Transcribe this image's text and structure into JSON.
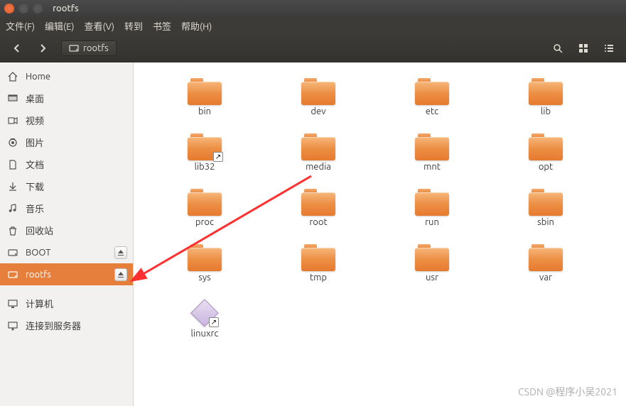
{
  "window": {
    "title": "rootfs"
  },
  "menubar": [
    "文件(F)",
    "编辑(E)",
    "查看(V)",
    "转到",
    "书签",
    "帮助(H)"
  ],
  "path": {
    "current": "rootfs"
  },
  "sidebar": {
    "items": [
      {
        "icon": "home",
        "label": "Home",
        "active": false
      },
      {
        "icon": "desktop",
        "label": "桌面",
        "active": false
      },
      {
        "icon": "video",
        "label": "视频",
        "active": false
      },
      {
        "icon": "pictures",
        "label": "图片",
        "active": false
      },
      {
        "icon": "documents",
        "label": "文档",
        "active": false
      },
      {
        "icon": "downloads",
        "label": "下载",
        "active": false
      },
      {
        "icon": "music",
        "label": "音乐",
        "active": false
      },
      {
        "icon": "trash",
        "label": "回收站",
        "active": false
      },
      {
        "icon": "drive",
        "label": "BOOT",
        "active": false,
        "eject": true
      },
      {
        "icon": "drive",
        "label": "rootfs",
        "active": true,
        "eject": true
      }
    ],
    "footer": [
      {
        "icon": "computer",
        "label": "计算机"
      },
      {
        "icon": "network",
        "label": "连接到服务器"
      }
    ]
  },
  "files": [
    {
      "type": "folder",
      "label": "bin"
    },
    {
      "type": "folder",
      "label": "dev"
    },
    {
      "type": "folder",
      "label": "etc"
    },
    {
      "type": "folder",
      "label": "lib"
    },
    {
      "type": "folder",
      "label": "lib32",
      "shortcut": true
    },
    {
      "type": "folder",
      "label": "media"
    },
    {
      "type": "folder",
      "label": "mnt"
    },
    {
      "type": "folder",
      "label": "opt"
    },
    {
      "type": "folder",
      "label": "proc"
    },
    {
      "type": "folder",
      "label": "root"
    },
    {
      "type": "folder",
      "label": "run"
    },
    {
      "type": "folder",
      "label": "sbin"
    },
    {
      "type": "folder",
      "label": "sys"
    },
    {
      "type": "folder",
      "label": "tmp"
    },
    {
      "type": "folder",
      "label": "usr"
    },
    {
      "type": "folder",
      "label": "var"
    },
    {
      "type": "exec",
      "label": "linuxrc",
      "shortcut": true
    }
  ],
  "watermark": "CSDN @程序小吴2021"
}
